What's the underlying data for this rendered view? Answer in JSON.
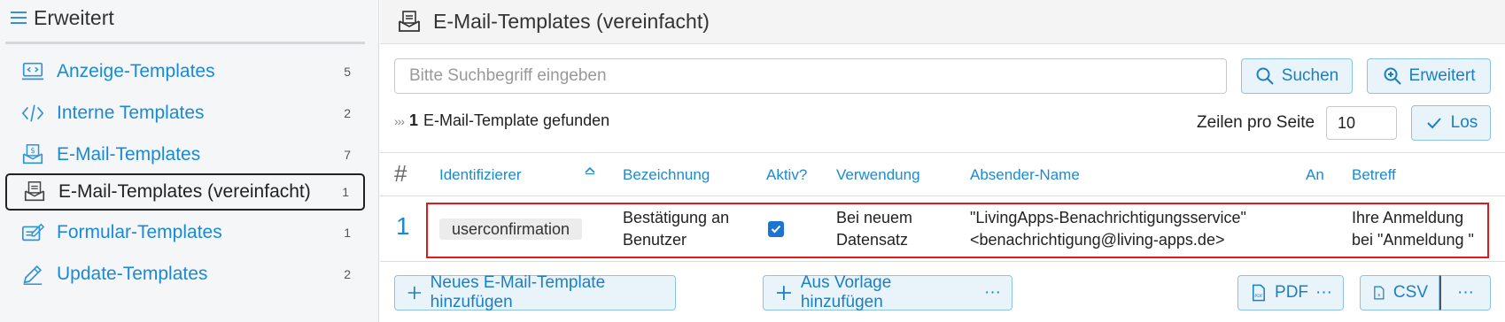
{
  "sidebar": {
    "title": "Erweitert",
    "items": [
      {
        "label": "Anzeige-Templates",
        "count": "5",
        "icon": "display-template-icon"
      },
      {
        "label": "Interne Templates",
        "count": "2",
        "icon": "code-icon"
      },
      {
        "label": "E-Mail-Templates",
        "count": "7",
        "icon": "email-template-icon"
      },
      {
        "label": "E-Mail-Templates (vereinfacht)",
        "count": "1",
        "icon": "email-simple-icon",
        "active": true
      },
      {
        "label": "Formular-Templates",
        "count": "1",
        "icon": "form-edit-icon"
      },
      {
        "label": "Update-Templates",
        "count": "2",
        "icon": "pencil-icon"
      }
    ]
  },
  "header": {
    "title": "E-Mail-Templates (vereinfacht)"
  },
  "search": {
    "placeholder": "Bitte Suchbegriff eingeben",
    "value": "",
    "search_label": "Suchen",
    "advanced_label": "Erweitert"
  },
  "results": {
    "count": "1",
    "text": "E-Mail-Template gefunden",
    "rows_per_page_label": "Zeilen pro Seite",
    "rows_per_page_value": "10",
    "go_label": "Los"
  },
  "table": {
    "columns": {
      "hash": "#",
      "identifier": "Identifizierer",
      "name": "Bezeichnung",
      "active": "Aktiv?",
      "usage": "Verwendung",
      "sender": "Absender-Name",
      "to": "An",
      "subject": "Betreff"
    },
    "rows": [
      {
        "num": "1",
        "identifier": "userconfirmation",
        "name_line1": "Bestätigung an",
        "name_line2": "Benutzer",
        "active": true,
        "usage_line1": "Bei neuem",
        "usage_line2": "Datensatz",
        "sender_line1": "\"LivingApps-Benachrichtigungsservice\"",
        "sender_line2": "<benachrichtigung@living-apps.de>",
        "to": "",
        "subject_line1": "Ihre Anmeldung",
        "subject_line2": "bei \"Anmeldung \""
      }
    ]
  },
  "actions": {
    "add_label": "Neues E-Mail-Template hinzufügen",
    "from_template_label": "Aus Vorlage hinzufügen",
    "pdf_label": "PDF",
    "csv_label": "CSV",
    "more": "···"
  },
  "colors": {
    "accent": "#1a8ad4",
    "highlight": "#e0191b",
    "button_bg": "#e9f3fa"
  }
}
